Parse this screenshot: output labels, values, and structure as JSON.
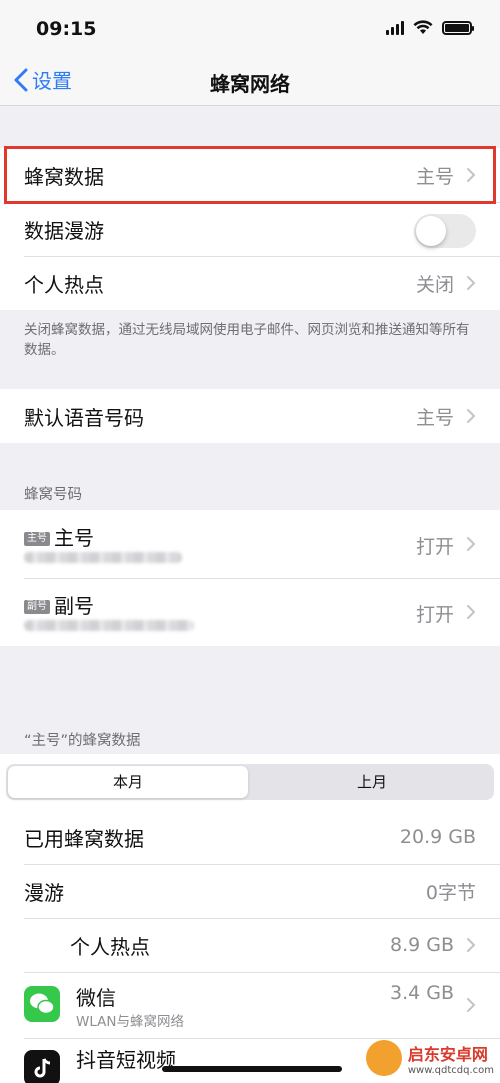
{
  "status": {
    "time": "09:15"
  },
  "nav": {
    "back_label": "设置",
    "title": "蜂窝网络"
  },
  "group1": {
    "cellular_data": {
      "label": "蜂窝数据",
      "value": "主号"
    },
    "data_roaming": {
      "label": "数据漫游",
      "enabled": false
    },
    "hotspot": {
      "label": "个人热点",
      "value": "关闭"
    }
  },
  "group1_footer": "关闭蜂窝数据，通过无线局域网使用电子邮件、网页浏览和推送通知等所有数据。",
  "default_voice": {
    "label": "默认语音号码",
    "value": "主号"
  },
  "cellular_plans": {
    "header": "蜂窝号码",
    "plans": [
      {
        "badge": "主号",
        "name": "主号",
        "value": "打开"
      },
      {
        "badge": "副号",
        "name": "副号",
        "value": "打开"
      }
    ]
  },
  "usage": {
    "header": "“主号”的蜂窝数据",
    "tabs": [
      "本月",
      "上月"
    ],
    "selected_tab": "本月",
    "used": {
      "label": "已用蜂窝数据",
      "value": "20.9 GB"
    },
    "roaming": {
      "label": "漫游",
      "value": "0字节"
    },
    "hotspot": {
      "label": "个人热点",
      "value": "8.9 GB"
    },
    "apps": [
      {
        "name": "微信",
        "subtitle": "WLAN与蜂窝网络",
        "value": "3.4 GB"
      },
      {
        "name": "抖音短视频"
      }
    ]
  },
  "watermark": {
    "title": "启东安卓网",
    "url": "www.qdtcdq.com"
  },
  "colors": {
    "accent": "#2f7cf6",
    "highlight": "#e0372f",
    "wechat": "#35c84a"
  }
}
